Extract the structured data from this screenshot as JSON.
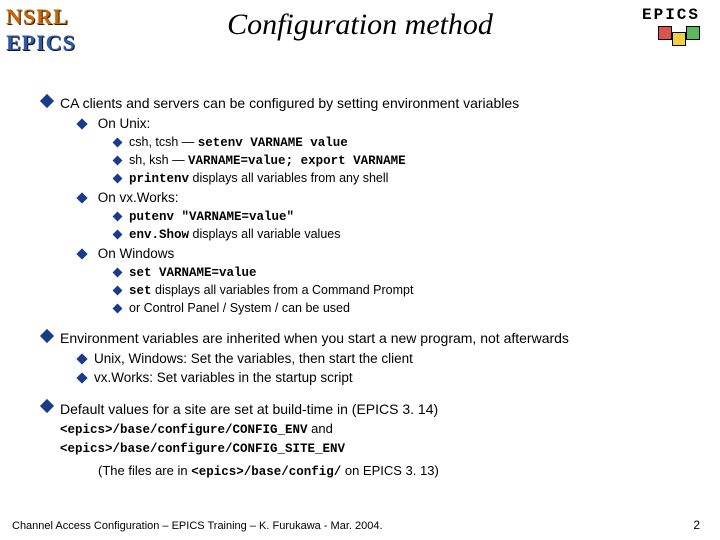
{
  "brand": {
    "side1": "NSRL",
    "side2": "EPICS",
    "cornerLabel": "EPICS"
  },
  "title": "Configuration method",
  "b1": {
    "head": "CA clients and servers can be configured by setting environment variables",
    "s1": {
      "head": "On Unix:",
      "i1a": "csh, tcsh — ",
      "i1b": "setenv VARNAME value",
      "i2a": "sh, ksh — ",
      "i2b": "VARNAME=value; export VARNAME",
      "i3a": "printenv",
      "i3b": " displays all variables from any shell"
    },
    "s2": {
      "head": "On vx.Works:",
      "i1a": "putenv \"VARNAME=value\"",
      "i2a": "env.Show",
      "i2b": " displays all variable values"
    },
    "s3": {
      "head": "On Windows",
      "i1a": "set VARNAME=value",
      "i2a": "set",
      "i2b": " displays all variables from a Command Prompt",
      "i3": "or Control Panel / System / can be used"
    }
  },
  "b2": {
    "head": "Environment variables are inherited when you start a new program, not afterwards",
    "i1": "Unix, Windows: Set the variables, then start the client",
    "i2": "vx.Works: Set variables in the startup script"
  },
  "b3": {
    "head": "Default values for a site are set at build-time in (EPICS 3. 14)",
    "p1": "<epics>/base/configure/CONFIG_ENV",
    "and": " and",
    "p2": "<epics>/base/configure/CONFIG_SITE_ENV",
    "note_a": "(The files are in ",
    "note_b": "<epics>/base/config/",
    "note_c": " on EPICS 3. 13)"
  },
  "footer": "Channel Access Configuration – EPICS Training – K. Furukawa - Mar. 2004.",
  "page": "2"
}
